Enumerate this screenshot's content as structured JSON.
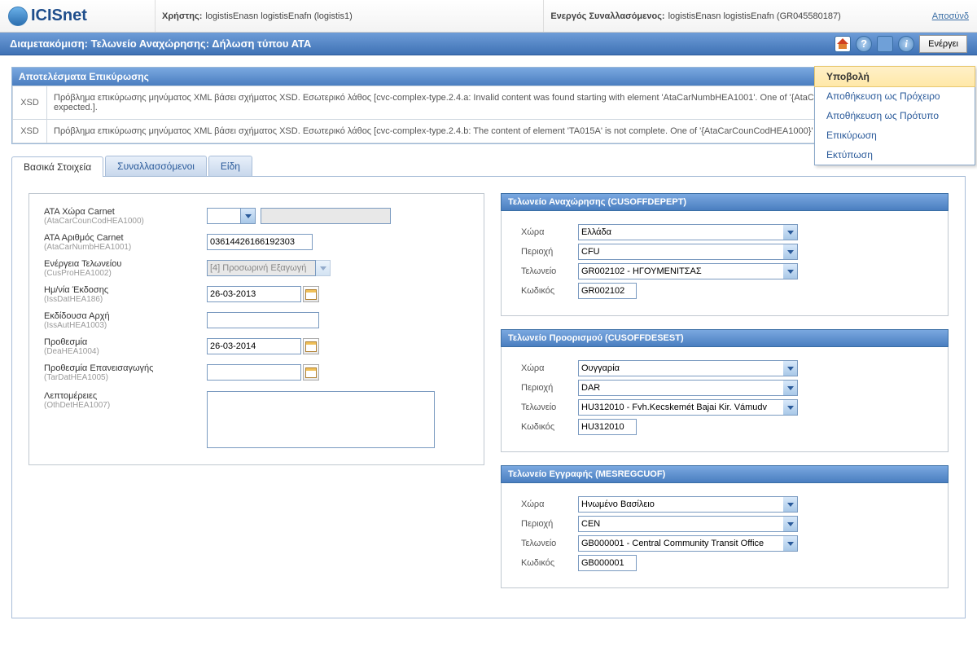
{
  "logo": "ICISnet",
  "header": {
    "userLabel": "Χρήστης:",
    "userValue": "logistisEnasn logistisEnafn (logistis1)",
    "activeLabel": "Ενεργός Συναλλασόμενος:",
    "activeValue": "logistisEnasn logistisEnafn (GR045580187)",
    "logout": "Αποσύνδ"
  },
  "title": "Διαμετακόμιση: Τελωνείο Αναχώρησης: Δήλωση τύπου ΑΤΑ",
  "actionsBtn": "Ενέργει",
  "menu": {
    "i0": "Υποβολή",
    "i1": "Αποθήκευση ως Πρόχειρο",
    "i2": "Αποθήκευση ως Πρότυπο",
    "i3": "Επικύρωση",
    "i4": "Εκτύπωση"
  },
  "validation": {
    "title": "Αποτελέσματα Επικύρωσης",
    "code": "XSD",
    "msg1": "Πρόβλημα επικύρωσης μηνύματος XML βάσει σχήματος XSD. Εσωτερικό λάθος [cvc-complex-type.2.4.a: Invalid content was found starting with element 'AtaCarNumbHEA1001'. One of '{AtaCarCounCodHEA1000}' is expected.].",
    "msg2": "Πρόβλημα επικύρωσης μηνύματος XML βάσει σχήματος XSD. Εσωτερικό λάθος [cvc-complex-type.2.4.b: The content of element 'TA015A' is not complete. One of '{AtaCarCounCodHEA1000}' is expected.]."
  },
  "tabs": {
    "t0": "Βασικά Στοιχεία",
    "t1": "Συναλλασσόμενοι",
    "t2": "Είδη"
  },
  "form": {
    "l1": "ΑΤΑ Χώρα Carnet",
    "s1": "(AtaCarCounCodHEA1000)",
    "l2": "ΑΤΑ Αριθμός Carnet",
    "s2": "(AtaCarNumbHEA1001)",
    "v2": "03614426166192303",
    "l3": "Ενέργεια Τελωνείου",
    "s3": "(CusProHEA1002)",
    "v3": "[4] Προσωρινή Εξαγωγή",
    "l4": "Ημ/νία Έκδοσης",
    "s4": "(IssDatHEA186)",
    "v4": "26-03-2013",
    "l5": "Εκδίδουσα Αρχή",
    "s5": "(IssAutHEA1003)",
    "l6": "Προθεσμία",
    "s6": "(DeaHEA1004)",
    "v6": "26-03-2014",
    "l7": "Προθεσμία Επανεισαγωγής",
    "s7": "(TarDatHEA1005)",
    "l8": "Λεπτομέρειες",
    "s8": "(OthDetHEA1007)"
  },
  "labels": {
    "country": "Χώρα",
    "region": "Περιοχή",
    "office": "Τελωνείο",
    "code": "Κωδικός"
  },
  "dep": {
    "title": "Τελωνείο Αναχώρησης (CUSOFFDEPEPT)",
    "country": "Ελλάδα",
    "region": "CFU",
    "office": "GR002102 - ΗΓΟΥΜΕΝΙΤΣΑΣ",
    "code": "GR002102"
  },
  "dest": {
    "title": "Τελωνείο Προορισμού (CUSOFFDESEST)",
    "country": "Ουγγαρία",
    "region": "DAR",
    "office": "HU312010 - Fvh.Kecskemét Bajai Kir. Vámudv",
    "code": "HU312010"
  },
  "reg": {
    "title": "Τελωνείο Εγγραφής (MESREGCUOF)",
    "country": "Ηνωμένο Βασίλειο",
    "region": "CEN",
    "office": "GB000001 - Central Community Transit Office",
    "code": "GB000001"
  }
}
